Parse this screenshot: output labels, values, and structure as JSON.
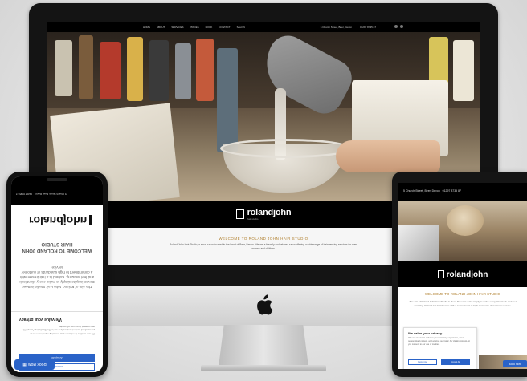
{
  "desktop": {
    "nav": {
      "menu": [
        "HOME",
        "ABOUT",
        "SERVICES",
        "PRICES",
        "BOOK",
        "CONTACT",
        "SALON"
      ],
      "address": "5 Church Street, Beer, Devon",
      "phone": "01297 8735 87"
    },
    "logo": {
      "name": "rolandjohn",
      "tagline": "hair studio"
    },
    "welcome_title": "WELCOME TO ROLAND JOHN HAIR STUDIO",
    "welcome_text": "Roland John Hair Studio, a small salon located in the heart of Beer, Devon. We are a friendly and relaxed salon offering a wide range of hairdressing services for men, women and children."
  },
  "phone": {
    "topbar": "5 Church Street, Beer, Devon",
    "phone": "01297 8735 87",
    "logo": "rolandjohn",
    "welcome_title": "WELCOME TO ROLAND JOHN HAIR STUDIO",
    "welcome_text": "The aim of Roland John Hair Studio in Beer, Devon is quite simply to make every client look and feel amazing. Roland is a hairdresser with a commitment to high standards of customer service.",
    "cookie": {
      "title": "We value your privacy",
      "body": "We use cookies to enhance your browsing experience, serve personalised content, and analyse our traffic. By clicking Accept All, you consent to our use of cookies.",
      "accept": "Accept All",
      "customise": "Customise"
    },
    "book_now": "Book Now"
  },
  "tablet": {
    "topbar": "5 Church Street, Beer, Devon",
    "phone": "01297 8735 87",
    "logo": "rolandjohn",
    "welcome_title": "WELCOME TO ROLAND JOHN HAIR STUDIO",
    "welcome_text": "The aim of Roland John Hair Studio in Beer, Devon is quite simply to make every client look and feel amazing. Roland is a hairdresser with a commitment to high standards of customer service.",
    "cookie": {
      "title": "We value your privacy",
      "body": "We use cookies to enhance your browsing experience, serve personalised content, and analyse our traffic. By clicking Accept All, you consent to our use of cookies.",
      "customise": "Customise",
      "accept": "Accept All"
    },
    "book_now": "Book Now"
  },
  "colors": {
    "accent_gold": "#b07f2d",
    "button_blue": "#2a63c8",
    "header_black": "#000000"
  }
}
